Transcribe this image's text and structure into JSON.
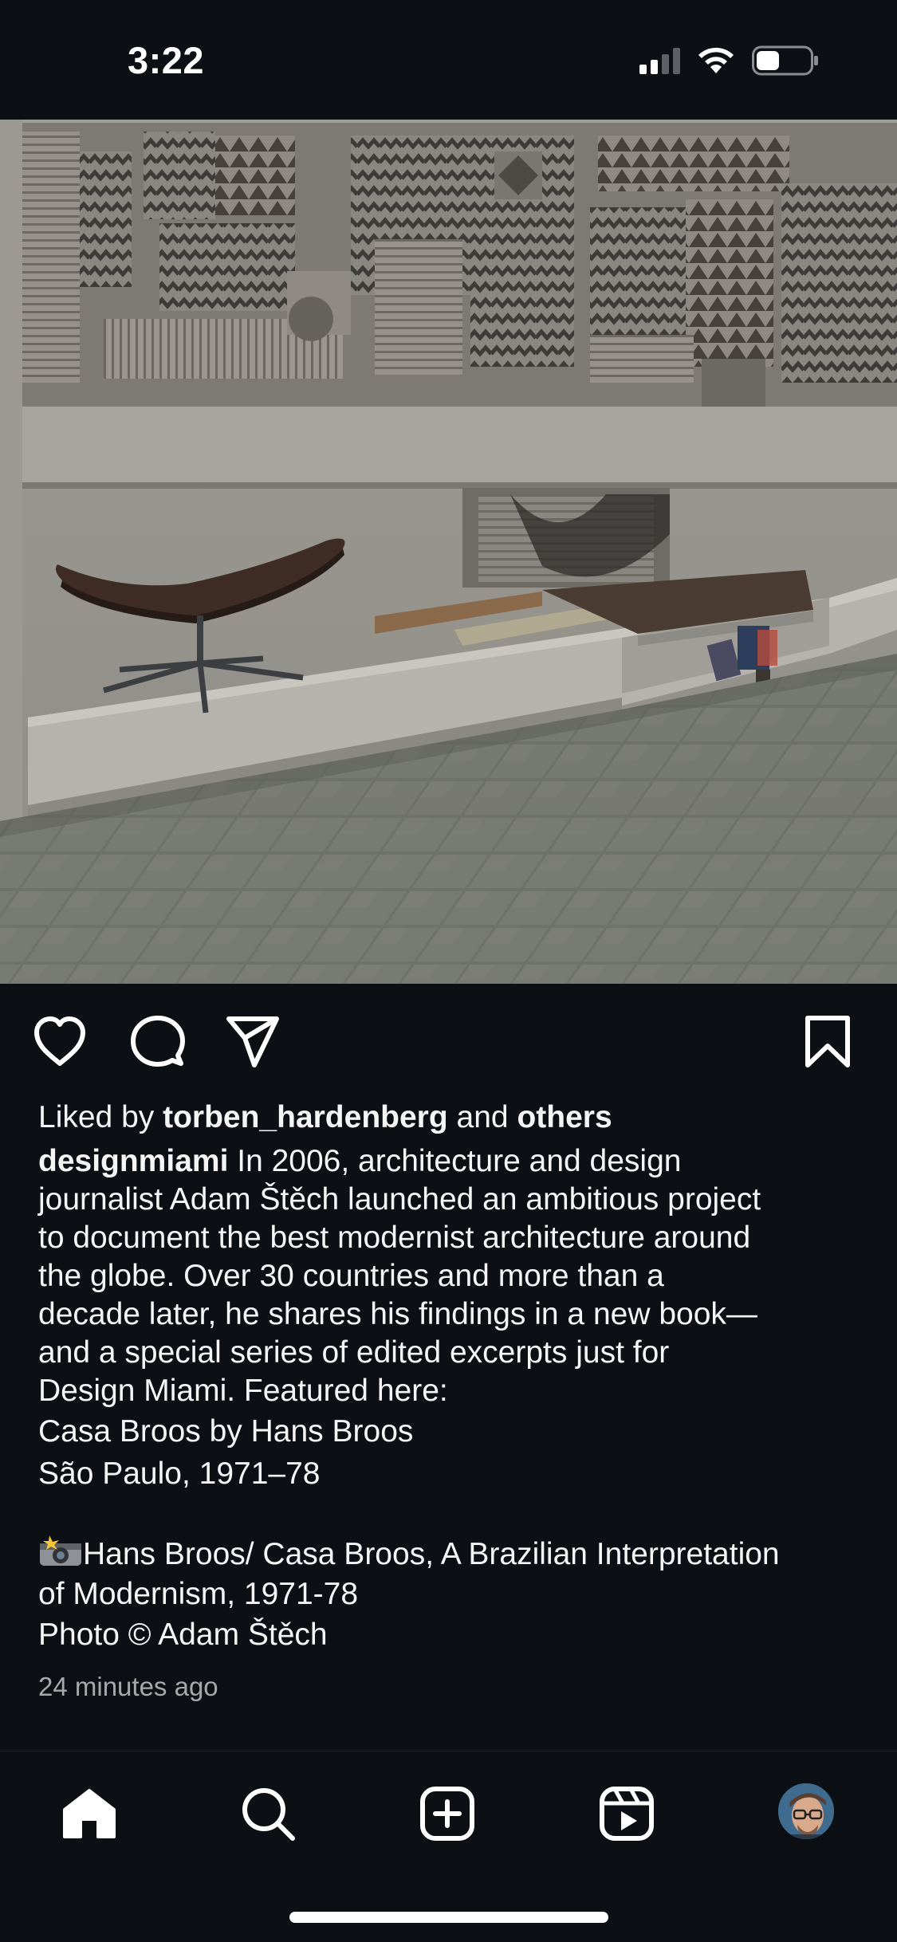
{
  "status_bar": {
    "time": "3:22"
  },
  "post": {
    "image_alt": "Concrete interior with relief wall, cantilevered bench and chair",
    "likes": {
      "prefix": "Liked by",
      "user": "torben_hardenberg",
      "conjunction": "and",
      "others": "others"
    },
    "caption": {
      "username": "designmiami",
      "line1": "In 2006, architecture and design",
      "line2": "journalist Adam Štěch launched an ambitious project",
      "line3": "to document the best modernist architecture around",
      "line4": "the globe. Over 30 countries and more than a",
      "line5": "decade later, he shares his findings in a new book—",
      "line6": "and a special series of edited excerpts just for",
      "line7": "Design Miami. Featured here:",
      "line8": "Casa Broos by Hans Broos",
      "line9": "São Paulo, 1971–78",
      "line10": "Hans Broos/ Casa Broos, A Brazilian Interpretation",
      "line11": "of Modernism, 1971-78",
      "line12": "Photo © Adam Štěch"
    },
    "timestamp": "24 minutes ago"
  },
  "icons": {
    "like": "heart-icon",
    "comment": "comment-icon",
    "share": "paper-plane-icon",
    "save": "bookmark-icon",
    "home": "home-icon",
    "search": "search-icon",
    "create": "plus-square-icon",
    "reels": "reels-icon",
    "camera_emoji": "camera-flash-emoji"
  },
  "colors": {
    "background": "#0c1014",
    "text": "#f5f5f5",
    "muted": "#a8a8a8"
  }
}
